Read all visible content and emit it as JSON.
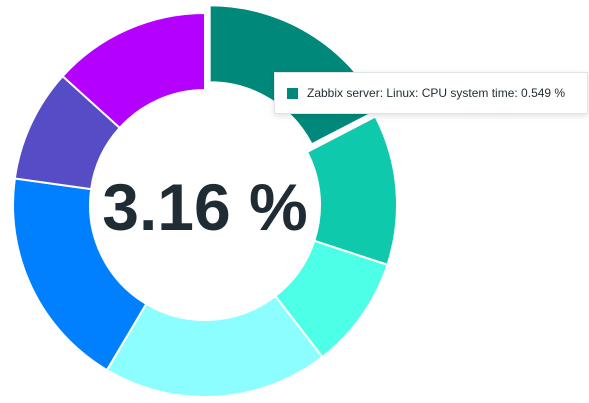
{
  "chart_data": {
    "type": "pie",
    "variant": "donut",
    "center_value": "3.16 %",
    "highlighted_index": 0,
    "slices": [
      {
        "value": 0.549,
        "color": "#00897b"
      },
      {
        "value": 0.4,
        "color": "#0ec9ac"
      },
      {
        "value": 0.3,
        "color": "#4dffe6"
      },
      {
        "value": 0.6,
        "color": "#8cfeff"
      },
      {
        "value": 0.59,
        "color": "#0080ff"
      },
      {
        "value": 0.3,
        "color": "#554cc6"
      },
      {
        "value": 0.42,
        "color": "#b300ff"
      }
    ]
  },
  "tooltip": {
    "text": "Zabbix server: Linux: CPU system time: 0.549 %",
    "swatch_color": "#00897b"
  }
}
